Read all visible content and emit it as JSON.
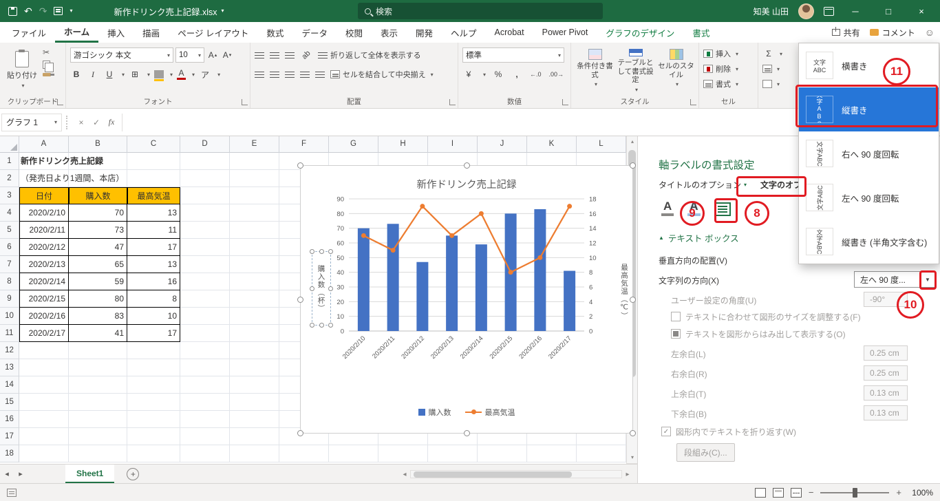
{
  "titlebar": {
    "filename": "新作ドリンク売上記録.xlsx",
    "search_placeholder": "検索",
    "user_name": "知美 山田"
  },
  "tabs_row": {
    "share_label": "共有",
    "comments_label": "コメント"
  },
  "ribbon_tabs": [
    {
      "label": "ファイル"
    },
    {
      "label": "ホーム",
      "state": "active"
    },
    {
      "label": "挿入"
    },
    {
      "label": "描画"
    },
    {
      "label": "ページ レイアウト"
    },
    {
      "label": "数式"
    },
    {
      "label": "データ"
    },
    {
      "label": "校閲"
    },
    {
      "label": "表示"
    },
    {
      "label": "開発"
    },
    {
      "label": "ヘルプ"
    },
    {
      "label": "Acrobat"
    },
    {
      "label": "Power Pivot"
    },
    {
      "label": "グラフのデザイン",
      "state": "contextual"
    },
    {
      "label": "書式",
      "state": "contextual"
    }
  ],
  "ribbon": {
    "paste_label": "貼り付け",
    "font_name": "游ゴシック 本文",
    "font_size": "10",
    "wrap_text_label": "折り返して全体を表示する",
    "merge_label": "セルを結合して中央揃え",
    "number_format": "標準",
    "styles": [
      "条件付き書式",
      "テーブルとして書式設定",
      "セルのスタイル"
    ],
    "cells": [
      "挿入",
      "削除",
      "書式"
    ],
    "group_labels": {
      "clipboard": "クリップボード",
      "font": "フォント",
      "alignment": "配置",
      "number": "数値",
      "styles": "スタイル",
      "cells": "セル"
    }
  },
  "formula_bar": {
    "name_box": "グラフ 1",
    "fx_label": "fx",
    "value": ""
  },
  "grid": {
    "columns": [
      "A",
      "B",
      "C",
      "D",
      "E",
      "F",
      "G",
      "H",
      "I",
      "J",
      "K",
      "L"
    ],
    "row_count": 18,
    "title_text": "新作ドリンク売上記録",
    "subtitle_text": "（発売日より1週間、本店）",
    "table": {
      "headers": [
        "日付",
        "購入数",
        "最高気温"
      ],
      "rows": [
        [
          "2020/2/10",
          "70",
          "13"
        ],
        [
          "2020/2/11",
          "73",
          "11"
        ],
        [
          "2020/2/12",
          "47",
          "17"
        ],
        [
          "2020/2/13",
          "65",
          "13"
        ],
        [
          "2020/2/14",
          "59",
          "16"
        ],
        [
          "2020/2/15",
          "80",
          "8"
        ],
        [
          "2020/2/16",
          "83",
          "10"
        ],
        [
          "2020/2/17",
          "41",
          "17"
        ]
      ]
    }
  },
  "chart_data": {
    "type": "bar+line",
    "title": "新作ドリンク売上記録",
    "categories": [
      "2020/2/10",
      "2020/2/11",
      "2020/2/12",
      "2020/2/13",
      "2020/2/14",
      "2020/2/15",
      "2020/2/16",
      "2020/2/17"
    ],
    "series": [
      {
        "name": "購入数",
        "type": "bar",
        "axis": "left",
        "color": "#4472C4",
        "values": [
          70,
          73,
          47,
          65,
          59,
          80,
          83,
          41
        ]
      },
      {
        "name": "最高気温",
        "type": "line",
        "axis": "right",
        "color": "#ED7D31",
        "values": [
          13,
          11,
          17,
          13,
          16,
          8,
          10,
          17
        ]
      }
    ],
    "left_axis": {
      "label": "購入数（杯）",
      "min": 0,
      "max": 90,
      "step": 10
    },
    "right_axis": {
      "label": "最高気温（℃）",
      "min": 0,
      "max": 18,
      "step": 2
    },
    "legend_position": "bottom",
    "grid": true
  },
  "task_pane": {
    "title": "軸ラベルの書式設定",
    "tab_title_options": "タイトルのオプション",
    "tab_text_options": "文字のオプション",
    "section_textbox": "テキスト ボックス",
    "vertical_alignment_label": "垂直方向の配置(V)",
    "text_direction_label": "文字列の方向(X)",
    "text_direction_value": "左へ 90 度...",
    "custom_angle_label": "ユーザー設定の角度(U)",
    "custom_angle_value": "-90°",
    "resize_shape_label": "テキストに合わせて図形のサイズを調整する(F)",
    "overflow_label": "テキストを図形からはみ出して表示する(O)",
    "margins": [
      {
        "label": "左余白(L)",
        "value": "0.25 cm"
      },
      {
        "label": "右余白(R)",
        "value": "0.25 cm"
      },
      {
        "label": "上余白(T)",
        "value": "0.13 cm"
      },
      {
        "label": "下余白(B)",
        "value": "0.13 cm"
      }
    ],
    "wrap_label": "図形内でテキストを折り返す(W)",
    "columns_button": "段組み(C)..."
  },
  "orientation_menu": {
    "icon_line1": "文字",
    "icon_line2": "ABC",
    "items": [
      {
        "label": "横書き",
        "selected": false,
        "icon": "text-horizontal-icon"
      },
      {
        "label": "縦書き",
        "selected": true,
        "icon": "text-vertical-icon"
      },
      {
        "label": "右へ 90 度回転",
        "selected": false,
        "icon": "rotate-right-icon"
      },
      {
        "label": "左へ 90 度回転",
        "selected": false,
        "icon": "rotate-left-icon"
      },
      {
        "label": "縦書き (半角文字含む)",
        "selected": false,
        "icon": "text-vertical-halfwidth-icon"
      }
    ]
  },
  "annotations": {
    "n8": "8",
    "n9": "9",
    "n10": "10",
    "n11": "11"
  },
  "sheet_tabs": {
    "active_tab": "Sheet1"
  },
  "status_bar": {
    "zoom_level": "100%"
  },
  "glyphs": {
    "caret": "▾",
    "dropdown": "▼",
    "close": "×",
    "minimize": "─",
    "restore": "□",
    "check": "✓",
    "cancel": "×",
    "undo": "↶",
    "redo": "↷",
    "smiley": "☺",
    "scissors": "✂",
    "sigma": "Σ",
    "percent": "%",
    "comma": ",",
    "plus": "+",
    "minus": "−",
    "navleft": "◂",
    "navright": "▸",
    "up": "▴",
    "down": "▾",
    "dec_inc": "←.0",
    "dec_dec": ".00→",
    "yen": "¥",
    "borders": "⊞",
    "orient": "ab",
    "phonetic": "ア"
  }
}
